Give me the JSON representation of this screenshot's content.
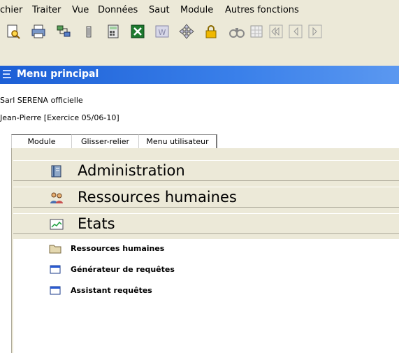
{
  "menubar": {
    "items": [
      {
        "label": "chier"
      },
      {
        "label": "Traiter"
      },
      {
        "label": "Vue"
      },
      {
        "label": "Données"
      },
      {
        "label": "Saut"
      },
      {
        "label": "Module"
      },
      {
        "label": "Autres fonctions"
      }
    ]
  },
  "toolbar": {
    "buttons": [
      "print-preview-icon",
      "print-icon",
      "network-icon",
      "trash-icon",
      "calculator-icon",
      "excel-icon",
      "word-icon",
      "move-icon",
      "lock-icon",
      "binoculars-icon",
      "grid-icon",
      "first-record-icon",
      "previous-record-icon",
      "next-record-icon"
    ]
  },
  "window": {
    "title": "Menu principal"
  },
  "info": {
    "company": "Sarl SERENA officielle",
    "user_exercise": "Jean-Pierre  [Exercice 05/06-10]"
  },
  "tabs": [
    {
      "label": "Module",
      "active": true
    },
    {
      "label": "Glisser-relier",
      "active": false
    },
    {
      "label": "Menu utilisateur",
      "active": false
    }
  ],
  "modules": [
    {
      "label": "Administration",
      "icon": "book-icon"
    },
    {
      "label": "Ressources humaines",
      "icon": "people-icon"
    },
    {
      "label": "Etats",
      "icon": "chart-icon"
    }
  ],
  "subitems": [
    {
      "label": "Ressources humaines",
      "icon": "folder-icon"
    },
    {
      "label": "Générateur de requêtes",
      "icon": "window-icon"
    },
    {
      "label": "Assistant requêtes",
      "icon": "window-icon"
    }
  ]
}
